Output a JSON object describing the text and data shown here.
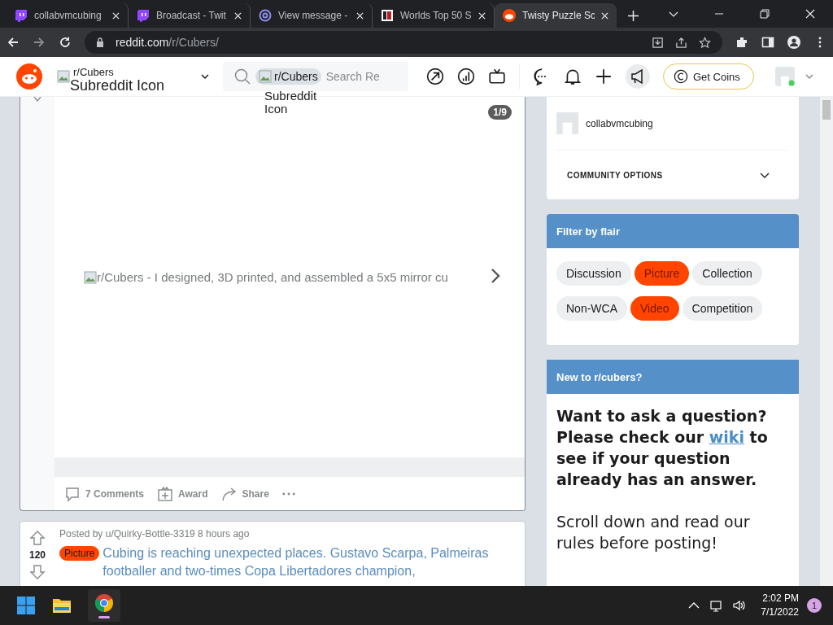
{
  "browser": {
    "tabs": [
      {
        "title": "collabvmcubing",
        "kind": "twitch",
        "selected": false
      },
      {
        "title": "Broadcast - Twit",
        "kind": "twitch",
        "selected": false
      },
      {
        "title": "View message -",
        "kind": "mail",
        "selected": false
      },
      {
        "title": "Worlds Top 50 S",
        "kind": "site",
        "selected": false
      },
      {
        "title": "Twisty Puzzle Sc",
        "kind": "reddit",
        "selected": true
      }
    ],
    "url_host": "reddit.com",
    "url_path": "/r/Cubers/"
  },
  "header": {
    "community": "r/Cubers",
    "community_icon_alt": "Subreddit Icon",
    "search_chip": "r/Cubers",
    "search_chip_alt": "Subreddit Icon",
    "search_placeholder": "Search Re",
    "coins_button": "Get Coins"
  },
  "post": {
    "image_counter": "1/9",
    "image_alt": "r/Cubers - I designed, 3D printed, and assembled a 5x5 mirror cu",
    "actions": [
      {
        "kind": "comments",
        "label": "7 Comments"
      },
      {
        "kind": "award",
        "label": "Award"
      },
      {
        "kind": "share",
        "label": "Share"
      },
      {
        "kind": "more"
      }
    ]
  },
  "next_post": {
    "byline": "Posted by u/Quirky-Bottle-3319 8 hours ago",
    "votes": "120",
    "flair": "Picture",
    "title": "Cubing is reaching unexpected places. Gustavo Scarpa, Palmeiras footballer and two-times Copa Libertadores champion,"
  },
  "sidebar": {
    "user": "collabvmcubing",
    "options_label": "COMMUNITY OPTIONS",
    "flair_title": "Filter by flair",
    "flairs": [
      {
        "label": "Discussion",
        "color": "#edeff1"
      },
      {
        "label": "Picture",
        "color": "#ff4500"
      },
      {
        "label": "Collection",
        "color": "#edeff1"
      },
      {
        "label": "Non-WCA",
        "color": "#edeff1"
      },
      {
        "label": "Video",
        "color": "#ff4500"
      },
      {
        "label": "Competition",
        "color": "#edeff1"
      }
    ],
    "welcome_title": "New to r/cubers?",
    "question_before": "Want to ask a question? Please check our ",
    "question_link": "wiki",
    "question_after": " to see if your question already has an answer.",
    "rules_text": "Scroll down and read our rules before posting!"
  },
  "taskbar": {
    "time": "2:02 PM",
    "date": "7/1/2022",
    "notifications": "1"
  }
}
